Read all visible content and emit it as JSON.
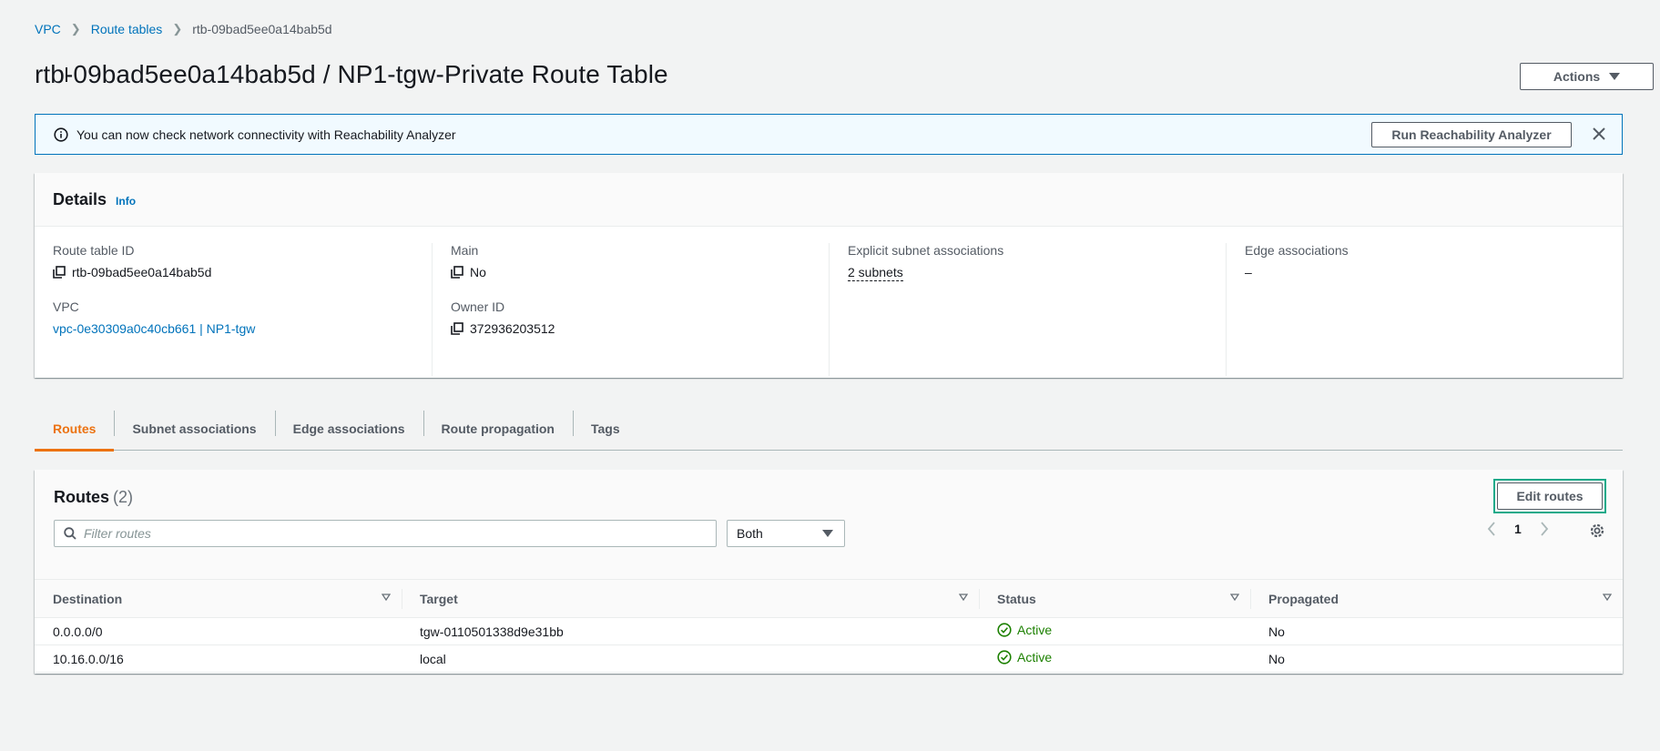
{
  "breadcrumb": {
    "items": [
      {
        "label": "VPC"
      },
      {
        "label": "Route tables"
      }
    ],
    "current": "rtb-09bad5ee0a14bab5d"
  },
  "page": {
    "title": "rtb-09bad5ee0a14bab5d / NP1-tgw-Private Route Table",
    "actions_label": "Actions"
  },
  "flash": {
    "message": "You can now check network connectivity with Reachability Analyzer",
    "button_label": "Run Reachability Analyzer"
  },
  "details": {
    "title": "Details",
    "info_label": "Info",
    "route_table_id_label": "Route table ID",
    "route_table_id": "rtb-09bad5ee0a14bab5d",
    "vpc_label": "VPC",
    "vpc_value": "vpc-0e30309a0c40cb661 | NP1-tgw",
    "main_label": "Main",
    "main_value": "No",
    "owner_label": "Owner ID",
    "owner_value": "372936203512",
    "explicit_label": "Explicit subnet associations",
    "explicit_value": "2 subnets",
    "edge_label": "Edge associations",
    "edge_value": "–"
  },
  "tabs": [
    {
      "label": "Routes",
      "active": true
    },
    {
      "label": "Subnet associations",
      "active": false
    },
    {
      "label": "Edge associations",
      "active": false
    },
    {
      "label": "Route propagation",
      "active": false
    },
    {
      "label": "Tags",
      "active": false
    }
  ],
  "routes": {
    "title": "Routes",
    "count": "(2)",
    "edit_label": "Edit routes",
    "filter_placeholder": "Filter routes",
    "filter_select": "Both",
    "page_number": "1",
    "columns": [
      "Destination",
      "Target",
      "Status",
      "Propagated"
    ],
    "rows": [
      {
        "destination": "0.0.0.0/0",
        "target": "tgw-0110501338d9e31bb",
        "status": "Active",
        "propagated": "No"
      },
      {
        "destination": "10.16.0.0/16",
        "target": "local",
        "status": "Active",
        "propagated": "No"
      }
    ]
  },
  "colors": {
    "link": "#0073bb",
    "active_tab": "#ec7211",
    "status_active": "#1d8102",
    "focus_ring": "#1aaa8a"
  }
}
